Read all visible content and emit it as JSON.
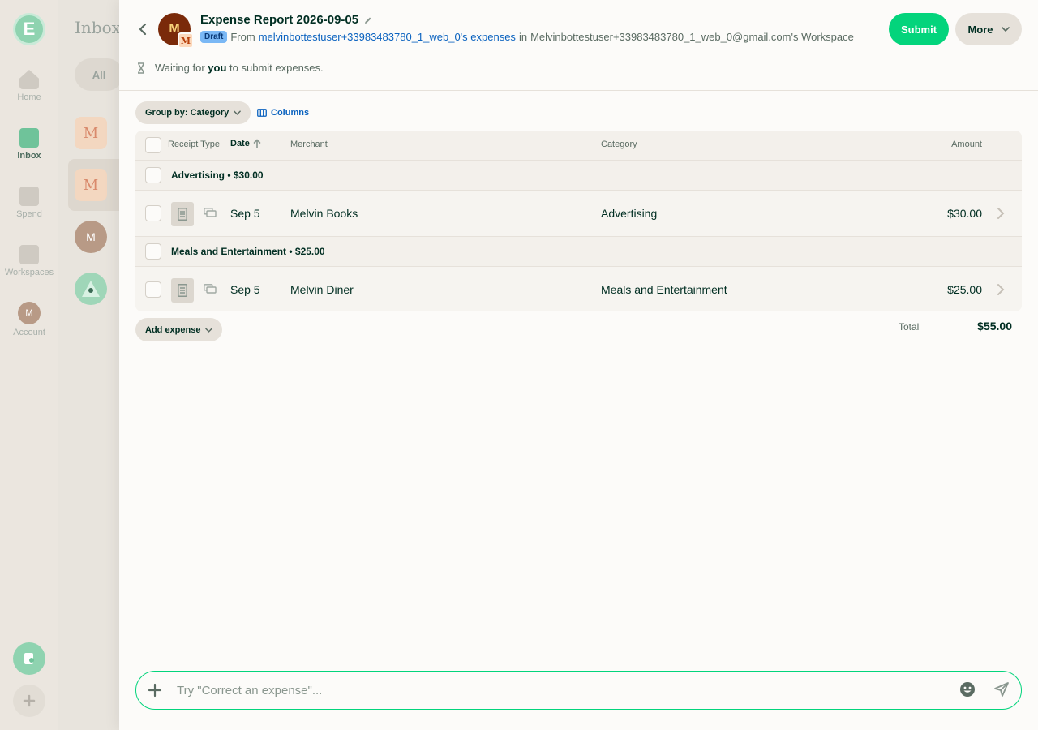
{
  "rail": {
    "logo_letter": "E",
    "items": [
      {
        "label": "Home",
        "icon": "home-icon"
      },
      {
        "label": "Inbox",
        "icon": "inbox-icon"
      },
      {
        "label": "Spend",
        "icon": "receipt-icon"
      },
      {
        "label": "Workspaces",
        "icon": "building-icon"
      },
      {
        "label": "Account",
        "icon": "avatar"
      }
    ],
    "account_initial": "M"
  },
  "inbox": {
    "title": "Inbox",
    "filter_all": "All",
    "row_initials": [
      "M",
      "M",
      "M"
    ]
  },
  "report": {
    "title": "Expense Report 2026-09-05",
    "avatar_initial": "M",
    "workspace_initial": "M",
    "status_badge": "Draft",
    "from_prefix": "From",
    "from_link": "melvinbottestuser+33983483780_1_web_0's expenses",
    "in_prefix": "in",
    "workspace_name": "Melvinbottestuser+33983483780_1_web_0@gmail.com's Workspace",
    "submit_label": "Submit",
    "more_label": "More",
    "waiting_prefix": "Waiting for",
    "waiting_bold": "you",
    "waiting_suffix": "to submit expenses."
  },
  "toolbar": {
    "group_by_label": "Group by: Category",
    "columns_label": "Columns"
  },
  "table": {
    "columns": {
      "receipt_type": "Receipt Type",
      "date": "Date",
      "merchant": "Merchant",
      "category": "Category",
      "amount": "Amount"
    },
    "groups": [
      {
        "label": "Advertising • $30.00",
        "items": [
          {
            "date": "Sep 5",
            "merchant": "Melvin Books",
            "category": "Advertising",
            "amount": "$30.00"
          }
        ]
      },
      {
        "label": "Meals and Entertainment • $25.00",
        "items": [
          {
            "date": "Sep 5",
            "merchant": "Melvin Diner",
            "category": "Meals and Entertainment",
            "amount": "$25.00"
          }
        ]
      }
    ]
  },
  "footer": {
    "add_expense_label": "Add expense",
    "total_label": "Total",
    "total_value": "$55.00"
  },
  "composer": {
    "placeholder": "Try \"Correct an expense\"..."
  },
  "colors": {
    "accent_green": "#03d47c",
    "link_blue": "#0a62bf",
    "draft_badge": "#7ab8f5"
  }
}
